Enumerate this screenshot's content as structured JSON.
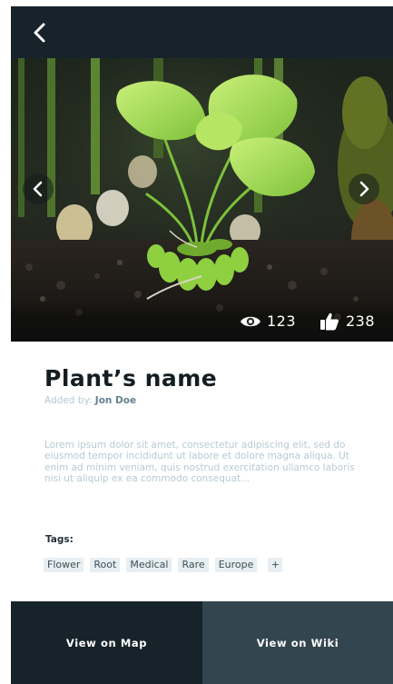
{
  "header": {
    "back_icon": "chevron-left-icon"
  },
  "gallery": {
    "prev_icon": "chevron-left-icon",
    "next_icon": "chevron-right-icon",
    "views_icon": "eye-icon",
    "views_count": "123",
    "likes_icon": "thumbs-up-icon",
    "likes_count": "238"
  },
  "plant": {
    "name": "Plant’s name",
    "added_by_prefix": "Added by:",
    "author": "Jon Doe",
    "description": "Lorem ipsum dolor sit amet, consectetur adipiscing elit, sed do eiusmod tempor incididunt ut labore et dolore magna aliqua. Ut enim ad minim veniam, quis nostrud exercitation ullamco laboris nisi ut aliquip ex ea commodo consequat..."
  },
  "tags": {
    "label": "Tags:",
    "items": [
      "Flower",
      "Root",
      "Medical",
      "Rare",
      "Europe"
    ],
    "add_label": "+"
  },
  "actions": {
    "map_label": "View on Map",
    "wiki_label": "View on Wiki"
  },
  "colors": {
    "dark": "#17232a",
    "slate": "#33454e",
    "muted_text": "#b8cad3",
    "tag_bg": "#e8eef1"
  }
}
